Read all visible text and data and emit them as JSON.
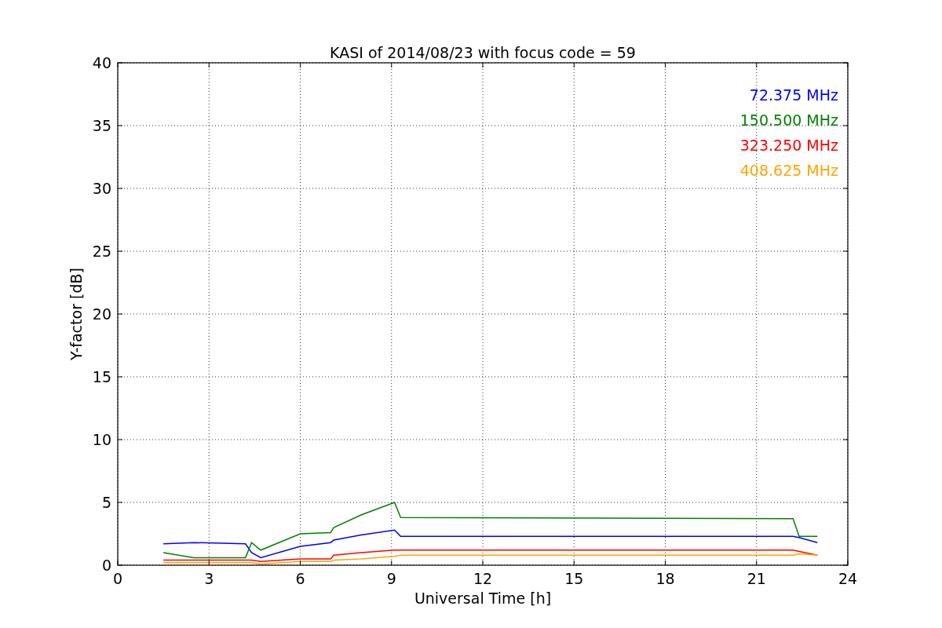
{
  "figure": {
    "chart_data": {
      "type": "line",
      "title": "KASI of 2014/08/23 with focus code = 59",
      "xlabel": "Universal Time [h]",
      "ylabel": "Y-factor [dB]",
      "x": [
        1.5,
        2.5,
        4.2,
        4.4,
        4.7,
        6.0,
        7.0,
        7.1,
        8.0,
        9.1,
        9.3,
        22.2,
        22.4,
        23.0
      ],
      "series": [
        {
          "name": "72.375 MHz",
          "color": "#0000ff",
          "values": [
            1.7,
            1.8,
            1.7,
            1.0,
            0.6,
            1.5,
            1.8,
            2.0,
            2.4,
            2.8,
            2.3,
            2.3,
            2.2,
            1.8
          ]
        },
        {
          "name": "150.500 MHz",
          "color": "#008000",
          "values": [
            1.0,
            0.6,
            0.6,
            1.8,
            1.2,
            2.5,
            2.6,
            3.0,
            4.0,
            5.0,
            3.8,
            3.7,
            2.3,
            2.3
          ]
        },
        {
          "name": "323.250 MHz",
          "color": "#ff0000",
          "values": [
            0.4,
            0.4,
            0.4,
            0.4,
            0.3,
            0.5,
            0.5,
            0.8,
            1.0,
            1.2,
            1.2,
            1.2,
            1.1,
            0.8
          ]
        },
        {
          "name": "408.625 MHz",
          "color": "#ffa500",
          "values": [
            0.2,
            0.2,
            0.2,
            0.2,
            0.1,
            0.3,
            0.3,
            0.4,
            0.5,
            0.7,
            0.8,
            0.8,
            0.9,
            0.8
          ]
        }
      ],
      "grid": true,
      "xlim": [
        0,
        24
      ],
      "ylim": [
        0,
        40
      ],
      "xticks": [
        0,
        3,
        6,
        9,
        12,
        15,
        18,
        21,
        24
      ],
      "yticks": [
        0,
        5,
        10,
        15,
        20,
        25,
        30,
        35,
        40
      ]
    }
  }
}
